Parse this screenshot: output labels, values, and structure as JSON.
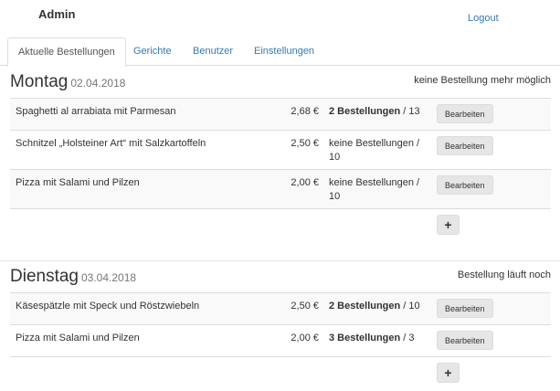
{
  "header": {
    "brand": "Admin",
    "logout": "Logout"
  },
  "tabs": [
    {
      "label": "Aktuelle Bestellungen",
      "active": true
    },
    {
      "label": "Gerichte",
      "active": false
    },
    {
      "label": "Benutzer",
      "active": false
    },
    {
      "label": "Einstellungen",
      "active": false
    }
  ],
  "days": [
    {
      "name": "Montag",
      "date": "02.04.2018",
      "status": "keine Bestellung mehr möglich",
      "rows": [
        {
          "dish": "Spaghetti al arrabiata mit Parmesan",
          "price": "2,68 €",
          "orders_bold": "2 Bestellungen",
          "orders_rest": " / 13",
          "action": "Bearbeiten"
        },
        {
          "dish": "Schnitzel „Holsteiner Art“ mit Salzkartoffeln",
          "price": "2,50 €",
          "orders_bold": "",
          "orders_rest": "keine Bestellungen / 10",
          "action": "Bearbeiten"
        },
        {
          "dish": "Pizza mit Salami und Pilzen",
          "price": "2,00 €",
          "orders_bold": "",
          "orders_rest": "keine Bestellungen / 10",
          "action": "Bearbeiten"
        }
      ],
      "add_label": "+"
    },
    {
      "name": "Dienstag",
      "date": "03.04.2018",
      "status": "Bestellung läuft noch",
      "rows": [
        {
          "dish": "Käsespätzle mit Speck und Röstzwiebeln",
          "price": "2,50 €",
          "orders_bold": "2 Bestellungen",
          "orders_rest": " / 10",
          "action": "Bearbeiten"
        },
        {
          "dish": "Pizza mit Salami und Pilzen",
          "price": "2,00 €",
          "orders_bold": "3 Bestellungen",
          "orders_rest": " / 3",
          "action": "Bearbeiten"
        }
      ],
      "add_label": "+"
    }
  ]
}
